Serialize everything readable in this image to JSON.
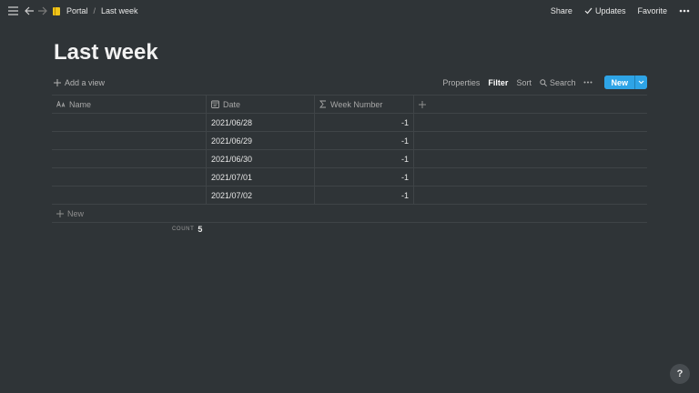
{
  "breadcrumb": {
    "parent": "Portal",
    "separator": "/",
    "current": "Last week"
  },
  "topbar_actions": {
    "share": "Share",
    "updates": "Updates",
    "favorite": "Favorite"
  },
  "page": {
    "title": "Last week"
  },
  "viewbar": {
    "add_view": "Add a view",
    "properties": "Properties",
    "filter": "Filter",
    "sort": "Sort",
    "search": "Search",
    "new_button": "New"
  },
  "table": {
    "columns": [
      {
        "label": "Name",
        "icon": "text-aa-icon"
      },
      {
        "label": "Date",
        "icon": "calendar-icon"
      },
      {
        "label": "Week Number",
        "icon": "sigma-icon"
      }
    ],
    "rows": [
      {
        "name": "",
        "date": "2021/06/28",
        "week": "-1"
      },
      {
        "name": "",
        "date": "2021/06/29",
        "week": "-1"
      },
      {
        "name": "",
        "date": "2021/06/30",
        "week": "-1"
      },
      {
        "name": "",
        "date": "2021/07/01",
        "week": "-1"
      },
      {
        "name": "",
        "date": "2021/07/02",
        "week": "-1"
      }
    ],
    "new_row": "New",
    "count_label": "COUNT",
    "count_value": "5"
  },
  "help": "?",
  "colors": {
    "background": "#2f3437",
    "accent_new_button": "#2ea4e6",
    "page_icon": "#f0c419"
  }
}
